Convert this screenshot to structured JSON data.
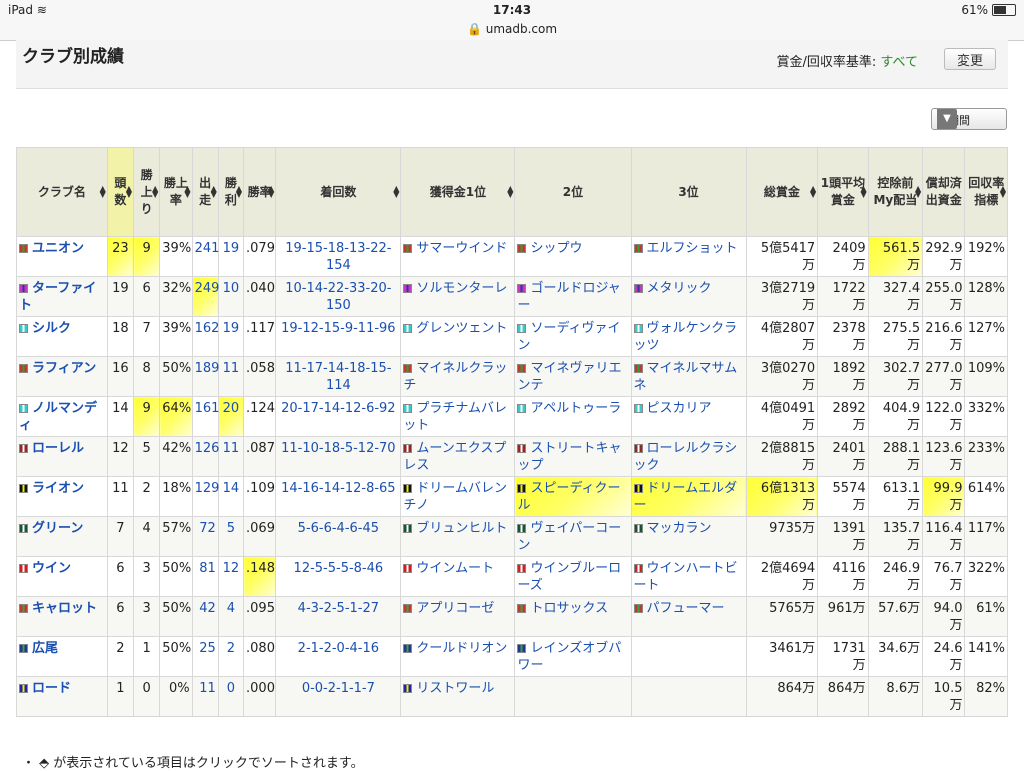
{
  "status": {
    "device": "iPad",
    "time": "17:43",
    "battery": "61%"
  },
  "url": "umadb.com",
  "panel": {
    "title": "クラブ別成績",
    "basis_label": "賞金/回収率基準:",
    "basis_value": "すべて",
    "change_button": "変更"
  },
  "period": {
    "selected": "全期間",
    "arrow": "▼"
  },
  "table": {
    "headers": [
      "クラブ名",
      "頭数",
      "勝上り",
      "勝上率",
      "出走",
      "勝利",
      "勝率",
      "着回数",
      "獲得金1位",
      "2位",
      "3位",
      "総賞金",
      "1頭平均賞金",
      "控除前My配当",
      "償却済出資金",
      "回収率指標"
    ],
    "rows": [
      {
        "club": "ユニオン",
        "flag": "#c33,#2a2",
        "heads": "23",
        "wu": "9",
        "wur": "39%",
        "starts": "241",
        "wins": "19",
        "wr": ".079",
        "pl": "19-15-18-13-22-154",
        "h1": "サマーウインド",
        "h2": "シップウ",
        "h3": "エルフショット",
        "total": "5億5417万",
        "avg": "2409万",
        "my": "561.5万",
        "dep": "292.9万",
        "ret": "192%",
        "hl": [
          0,
          1,
          12
        ]
      },
      {
        "club": "ターファイト",
        "flag": "#c3c,#339",
        "heads": "19",
        "wu": "6",
        "wur": "32%",
        "starts": "249",
        "wins": "10",
        "wr": ".040",
        "pl": "10-14-22-33-20-150",
        "h1": "ソルモンターレ",
        "h2": "ゴールドロジャー",
        "h3": "メタリック",
        "total": "3億2719万",
        "avg": "1722万",
        "my": "327.4万",
        "dep": "255.0万",
        "ret": "128%",
        "hl": [
          3
        ]
      },
      {
        "club": "シルク",
        "flag": "#3cc,#fff",
        "heads": "18",
        "wu": "7",
        "wur": "39%",
        "starts": "162",
        "wins": "19",
        "wr": ".117",
        "pl": "19-12-15-9-11-96",
        "h1": "グレンツェント",
        "h2": "ソーディヴァイン",
        "h3": "ヴォルケンクラッツ",
        "total": "4億2807万",
        "avg": "2378万",
        "my": "275.5万",
        "dep": "216.6万",
        "ret": "127%",
        "hl": []
      },
      {
        "club": "ラフィアン",
        "flag": "#c33,#2a2",
        "heads": "16",
        "wu": "8",
        "wur": "50%",
        "starts": "189",
        "wins": "11",
        "wr": ".058",
        "pl": "11-17-14-18-15-114",
        "h1": "マイネルクラッチ",
        "h2": "マイネヴァリエンテ",
        "h3": "マイネルマサムネ",
        "total": "3億0270万",
        "avg": "1892万",
        "my": "302.7万",
        "dep": "277.0万",
        "ret": "109%",
        "hl": []
      },
      {
        "club": "ノルマンディ",
        "flag": "#3cc,#fff",
        "heads": "14",
        "wu": "9",
        "wur": "64%",
        "starts": "161",
        "wins": "20",
        "wr": ".124",
        "pl": "20-17-14-12-6-92",
        "h1": "プラチナムバレット",
        "h2": "アペルトゥーラ",
        "h3": "ピスカリア",
        "total": "4億0491万",
        "avg": "2892万",
        "my": "404.9万",
        "dep": "122.0万",
        "ret": "332%",
        "hl": [
          1,
          2,
          4
        ]
      },
      {
        "club": "ローレル",
        "flag": "#922,#fff",
        "heads": "12",
        "wu": "5",
        "wur": "42%",
        "starts": "126",
        "wins": "11",
        "wr": ".087",
        "pl": "11-10-18-5-12-70",
        "h1": "ムーンエクスプレス",
        "h2": "ストリートキャップ",
        "h3": "ローレルクラシック",
        "total": "2億8815万",
        "avg": "2401万",
        "my": "288.1万",
        "dep": "123.6万",
        "ret": "233%",
        "hl": []
      },
      {
        "club": "ライオン",
        "flag": "#111,#ee0",
        "heads": "11",
        "wu": "2",
        "wur": "18%",
        "starts": "129",
        "wins": "14",
        "wr": ".109",
        "pl": "14-16-14-12-8-65",
        "h1": "ドリームバレンチノ",
        "h2": "スピーディクール",
        "h3": "ドリームエルダー",
        "total": "6億1313万",
        "avg": "5574万",
        "my": "613.1万",
        "dep": "99.9万",
        "ret": "614%",
        "hl": [
          8,
          9,
          10,
          13
        ]
      },
      {
        "club": "グリーン",
        "flag": "#153,#fff",
        "heads": "7",
        "wu": "4",
        "wur": "57%",
        "starts": "72",
        "wins": "5",
        "wr": ".069",
        "pl": "5-6-6-4-6-45",
        "h1": "ブリュンヒルト",
        "h2": "ヴェイパーコーン",
        "h3": "マッカラン",
        "total": "9735万",
        "avg": "1391万",
        "my": "135.7万",
        "dep": "116.4万",
        "ret": "117%",
        "hl": []
      },
      {
        "club": "ウイン",
        "flag": "#c22,#fff",
        "heads": "6",
        "wu": "3",
        "wur": "50%",
        "starts": "81",
        "wins": "12",
        "wr": ".148",
        "pl": "12-5-5-5-8-46",
        "h1": "ウインムート",
        "h2": "ウインブルーローズ",
        "h3": "ウインハートビート",
        "total": "2億4694万",
        "avg": "4116万",
        "my": "246.9万",
        "dep": "76.7万",
        "ret": "322%",
        "hl": [
          5
        ]
      },
      {
        "club": "キャロット",
        "flag": "#c33,#3a3",
        "heads": "6",
        "wu": "3",
        "wur": "50%",
        "starts": "42",
        "wins": "4",
        "wr": ".095",
        "pl": "4-3-2-5-1-27",
        "h1": "アプリコーゼ",
        "h2": "トロサックス",
        "h3": "パフューマー",
        "total": "5765万",
        "avg": "961万",
        "my": "57.6万",
        "dep": "94.0万",
        "ret": "61%",
        "hl": []
      },
      {
        "club": "広尾",
        "flag": "#239,#3a3",
        "heads": "2",
        "wu": "1",
        "wur": "50%",
        "starts": "25",
        "wins": "2",
        "wr": ".080",
        "pl": "2-1-2-0-4-16",
        "h1": "クールドリオン",
        "h2": "レインズオブパワー",
        "h3": "",
        "total": "3461万",
        "avg": "1731万",
        "my": "34.6万",
        "dep": "24.6万",
        "ret": "141%",
        "hl": []
      },
      {
        "club": "ロード",
        "flag": "#22a,#ee0",
        "heads": "1",
        "wu": "0",
        "wur": "0%",
        "starts": "11",
        "wins": "0",
        "wr": ".000",
        "pl": "0-0-2-1-1-7",
        "h1": "リストワール",
        "h2": "",
        "h3": "",
        "total": "864万",
        "avg": "864万",
        "my": "8.6万",
        "dep": "10.5万",
        "ret": "82%",
        "hl": []
      }
    ]
  },
  "footer": "・ ⬘ が表示されている項目はクリックでソートされます。"
}
